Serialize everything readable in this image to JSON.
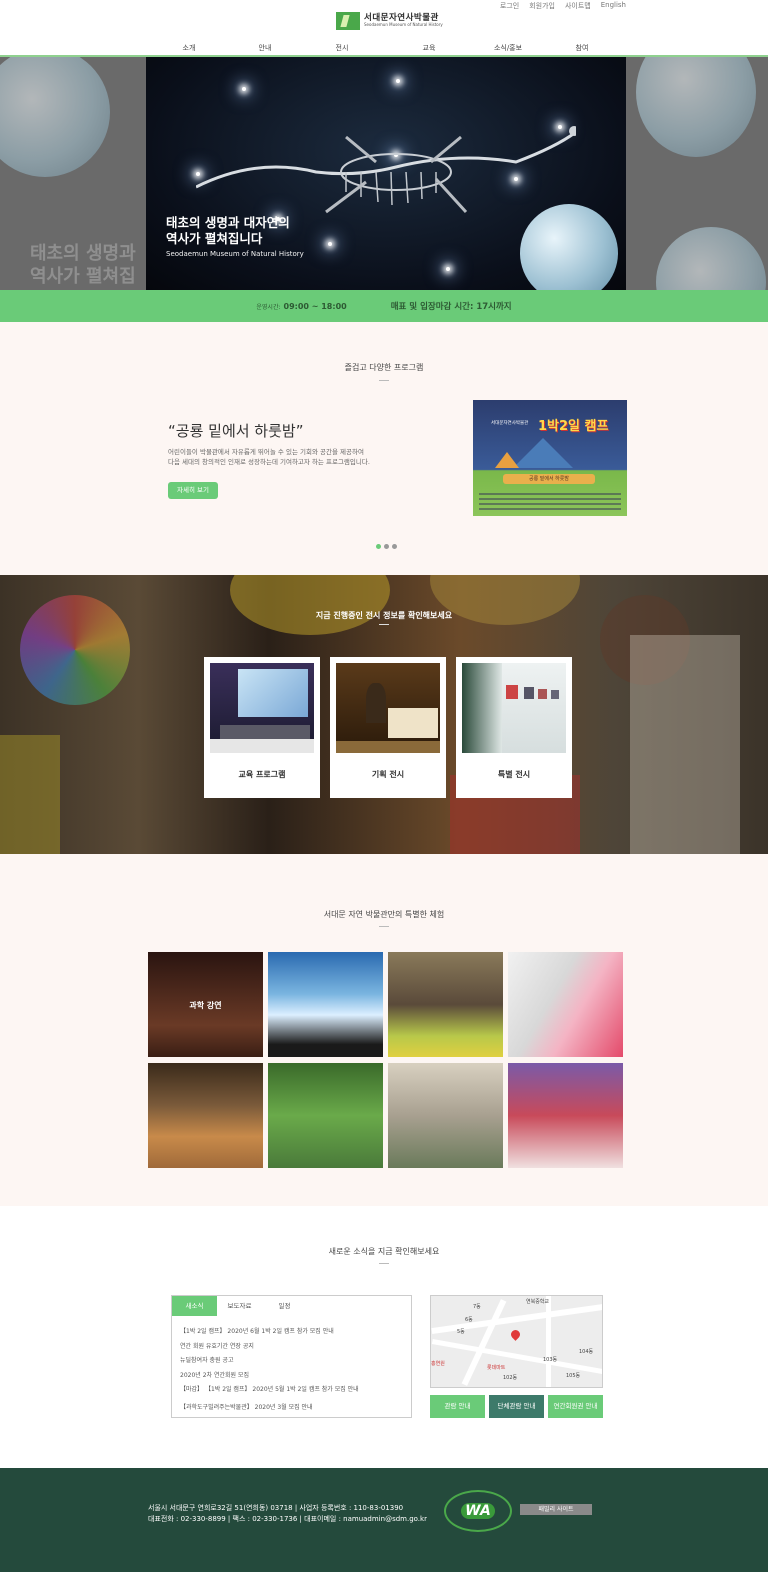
{
  "header": {
    "util_links": [
      "로그인",
      "회원가입",
      "사이트맵",
      "English"
    ],
    "logo_ko": "서대문자연사박물관",
    "logo_en": "Seodaemun Museum of Natural History",
    "nav": [
      "소개",
      "안내",
      "전시",
      "교육",
      "소식/홍보",
      "참여"
    ]
  },
  "hero": {
    "title": "태초의 생명과 대자연의\n역사가 펼쳐집니다",
    "subtitle": "Seodaemun Museum of Natural History",
    "side_text": "태초의 생명과\n역사가 펼쳐집"
  },
  "hours": {
    "open_label": "운영시간:",
    "open_value": "09:00 ~ 18:00",
    "close": "매표 및 입장마감 시간: 17시까지"
  },
  "program": {
    "section_title": "즐겁고 다양한 프로그램",
    "quote": "“공룡 밑에서 하룻밤”",
    "desc": "어린이들이 박물관에서 자유롭게 뛰어놀 수 있는 기회와 공간을 제공하여\n다음 세대의 창의적인 인재로 성장하는데 기여하고자 하는 프로그램입니다.",
    "button": "자세히 보기",
    "poster_head": "서대문자연사박물관",
    "poster_title": "1박2일 캠프",
    "poster_banner": "공룡 밑에서 하룻밤"
  },
  "exhibit": {
    "section_title": "지금 진행중인 전시 정보를 확인해보세요",
    "cards": [
      "교육 프로그램",
      "기획 전시",
      "특별 전시"
    ]
  },
  "experience": {
    "section_title": "서대문 자연 박물관만의 특별한 체험",
    "first_label": "과학 강연"
  },
  "news": {
    "section_title": "새로운 소식을 지금 확인해보세요",
    "tabs": [
      "새소식",
      "보도자료",
      "일정"
    ],
    "items": [
      "【1박 2일 캠프】 2020년 6월 1박 2일 캠프 참가 모집 안내",
      "연간 회원 유효기간 연장 공지",
      "뉴딜참여자 충원 공고",
      "2020년 2차 연간회원 모집",
      "【마감】 【1박 2일 캠프】 2020년 5월 1박 2일 캠프 참가 모집 안내",
      "【과학도구빌려주는박물관】 2020년 3월 모집 안내"
    ],
    "map_labels": [
      "연북중학교",
      "7동",
      "6동",
      "5동",
      "104동",
      "103동",
      "105동",
      "102동",
      "롯데마트",
      "홍연원"
    ],
    "buttons": [
      "관람 안내",
      "단체관람 안내",
      "연간회원권 안내"
    ]
  },
  "footer": {
    "address": "서울시 서대문구 연희로32길 51(연희동) 03718  |  사업자 등록번호 : 110-83-01390\n대표전화 : 02-330-8899  |  팩스 : 02-330-1736  |  대표이메일 : namuadmin@sdm.go.kr",
    "wa_logo": "WA",
    "family_site": "패밀리 사이트"
  },
  "colors": {
    "accent": "#6acb78",
    "footer": "#244a3c",
    "dark_button": "#3d7a6a"
  }
}
